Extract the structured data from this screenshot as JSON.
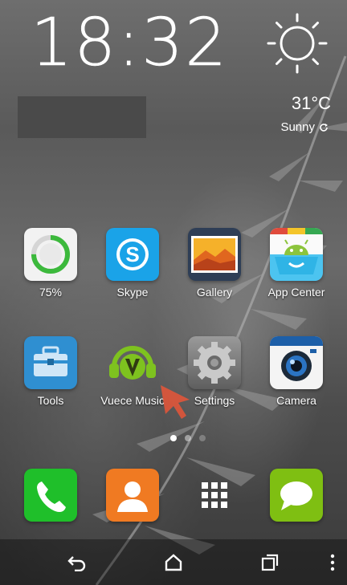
{
  "status": {
    "time": "18:32",
    "weather": {
      "icon": "sun-icon",
      "temperature": "31°C",
      "condition": "Sunny"
    }
  },
  "apps_row1": [
    {
      "label": "75%",
      "icon": "battery-widget-icon"
    },
    {
      "label": "Skype",
      "icon": "skype-icon"
    },
    {
      "label": "Gallery",
      "icon": "gallery-icon"
    },
    {
      "label": "App Center",
      "icon": "app-center-icon"
    }
  ],
  "apps_row2": [
    {
      "label": "Tools",
      "icon": "toolbox-icon"
    },
    {
      "label": "Vuece Music",
      "icon": "vuece-music-icon"
    },
    {
      "label": "Settings",
      "icon": "gear-icon"
    },
    {
      "label": "Camera",
      "icon": "camera-icon"
    }
  ],
  "page_indicator": {
    "pages": 3,
    "current": 0
  },
  "dock": [
    {
      "icon": "phone-icon"
    },
    {
      "icon": "contacts-icon"
    },
    {
      "icon": "app-drawer-icon"
    },
    {
      "icon": "messaging-icon"
    }
  ],
  "battery_level": 0.75,
  "colors": {
    "phone": "#1fbf2a",
    "contacts": "#f07a22",
    "messaging": "#7fbf12",
    "skype": "#1aa3e8",
    "cursor": "#e0553a"
  }
}
